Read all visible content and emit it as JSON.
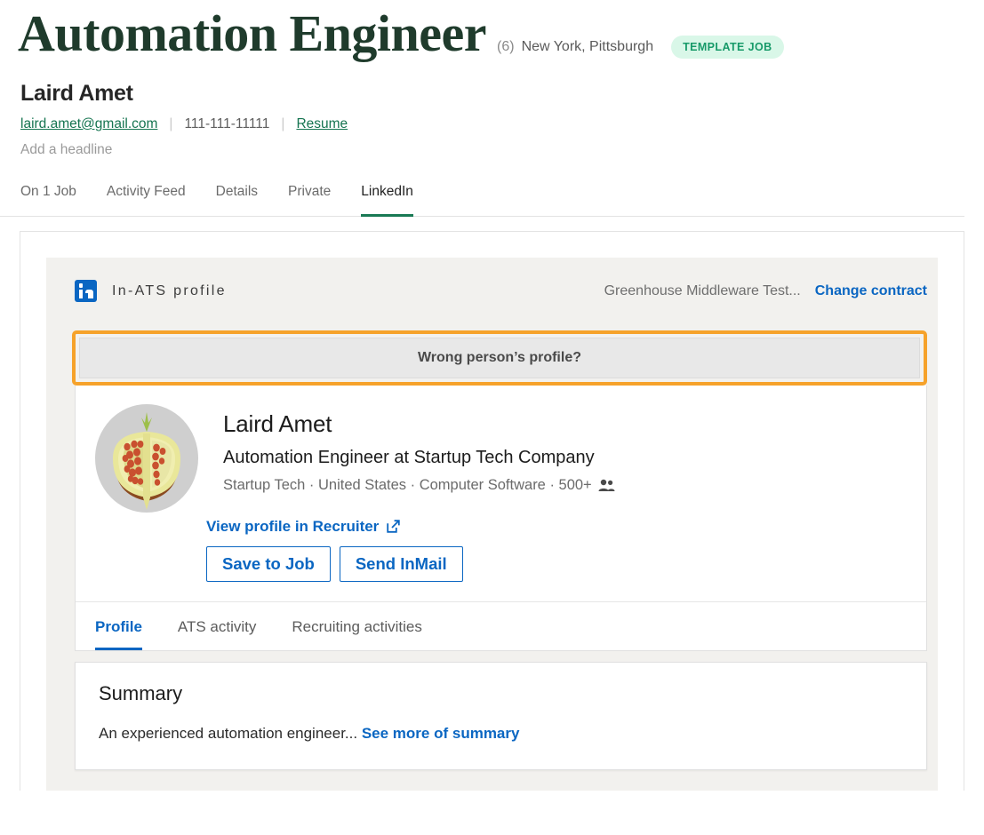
{
  "job": {
    "title": "Automation Engineer",
    "count": "(6)",
    "locations": "New York, Pittsburgh",
    "badge": "TEMPLATE JOB"
  },
  "candidate": {
    "name": "Laird Amet",
    "email": "laird.amet@gmail.com",
    "phone": "111-111-11111",
    "resume_label": "Resume",
    "headline_placeholder": "Add a headline"
  },
  "top_tabs": [
    {
      "label": "On 1 Job",
      "active": false
    },
    {
      "label": "Activity Feed",
      "active": false
    },
    {
      "label": "Details",
      "active": false
    },
    {
      "label": "Private",
      "active": false
    },
    {
      "label": "LinkedIn",
      "active": true
    }
  ],
  "ats": {
    "panel_title": "In-ATS profile",
    "contract_name": "Greenhouse Middleware Test...",
    "change_contract_label": "Change contract",
    "wrong_person_label": "Wrong person’s profile?"
  },
  "profile": {
    "name": "Laird Amet",
    "headline": "Automation Engineer at Startup Tech Company",
    "meta": "Startup Tech · United States · Computer Software · 500+",
    "recruiter_link": "View profile in Recruiter",
    "save_button": "Save to Job",
    "inmail_button": "Send InMail",
    "tabs": [
      {
        "label": "Profile",
        "active": true
      },
      {
        "label": "ATS activity",
        "active": false
      },
      {
        "label": "Recruiting activities",
        "active": false
      }
    ]
  },
  "summary": {
    "title": "Summary",
    "text": "An experienced automation engineer...",
    "see_more_label": "See more of summary"
  },
  "colors": {
    "brand_green": "#1f3b2c",
    "link_green": "#157450",
    "linkedin_blue": "#0a66c2",
    "highlight_orange": "#f6a22a",
    "badge_bg": "#d9f7e8",
    "badge_text": "#179a69",
    "panel_bg": "#f2f1ee"
  }
}
